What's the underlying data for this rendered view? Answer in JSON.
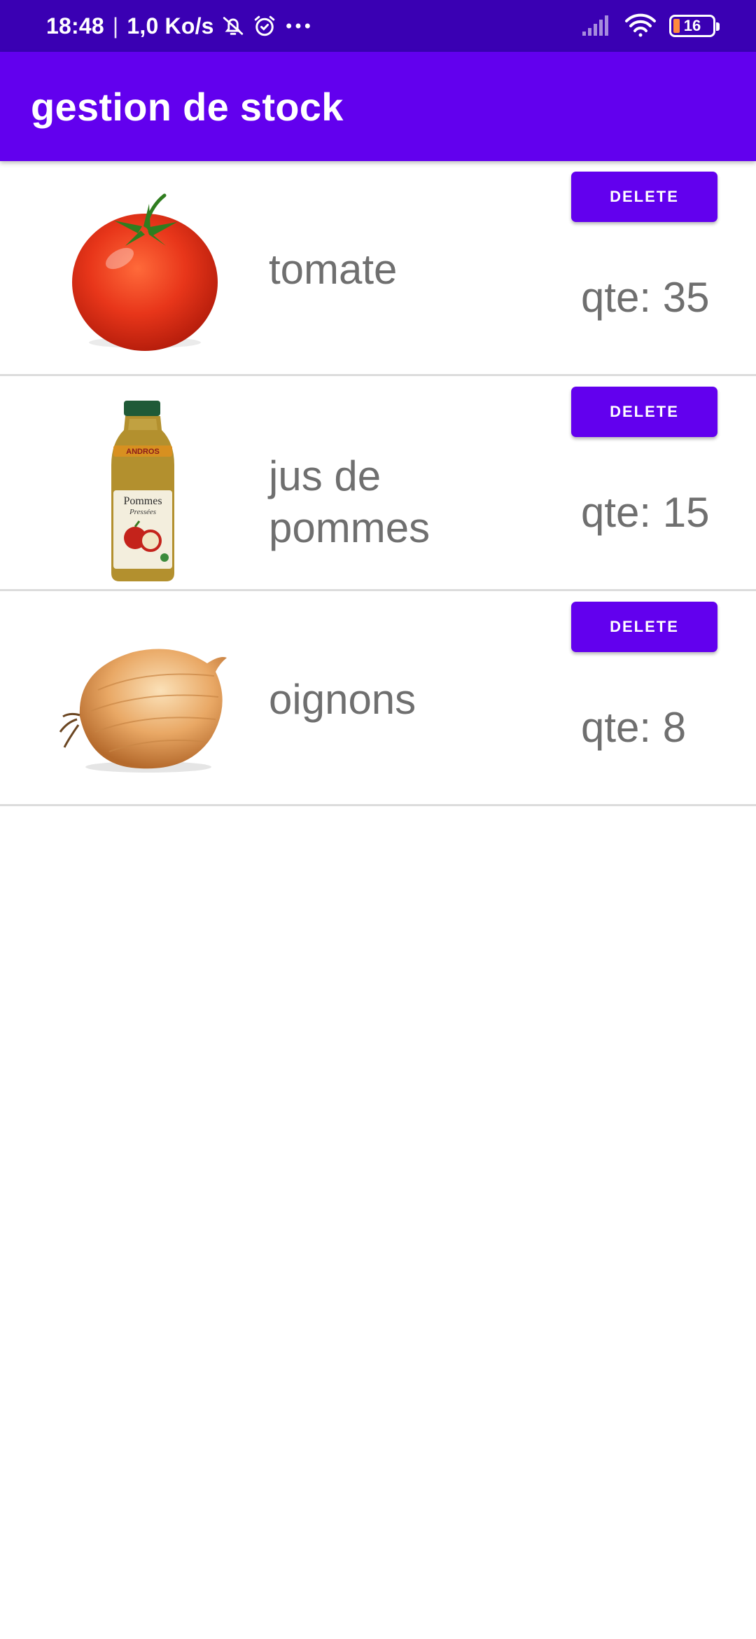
{
  "status_bar": {
    "time": "18:48",
    "separator": "|",
    "speed": "1,0 Ko/s",
    "icons": [
      "bell-off-icon",
      "alarm-icon",
      "more-dots-icon",
      "signal-icon",
      "wifi-icon",
      "battery-icon"
    ],
    "battery_level": "16",
    "battery_fraction": 0.16
  },
  "app_bar": {
    "title": "gestion de stock",
    "color": "#6200ee"
  },
  "items": [
    {
      "name": "tomate",
      "quantity": "qte: 35",
      "delete_label": "DELETE",
      "icon": "tomato-image"
    },
    {
      "name": "jus de pommes",
      "quantity": "qte: 15",
      "delete_label": "DELETE",
      "icon": "apple-juice-bottle-image",
      "label_brand": "ANDROS",
      "label_product": "Pommes",
      "label_sub": "Pressées"
    },
    {
      "name": "oignons",
      "quantity": "qte: 8",
      "delete_label": "DELETE",
      "icon": "onion-image"
    }
  ]
}
